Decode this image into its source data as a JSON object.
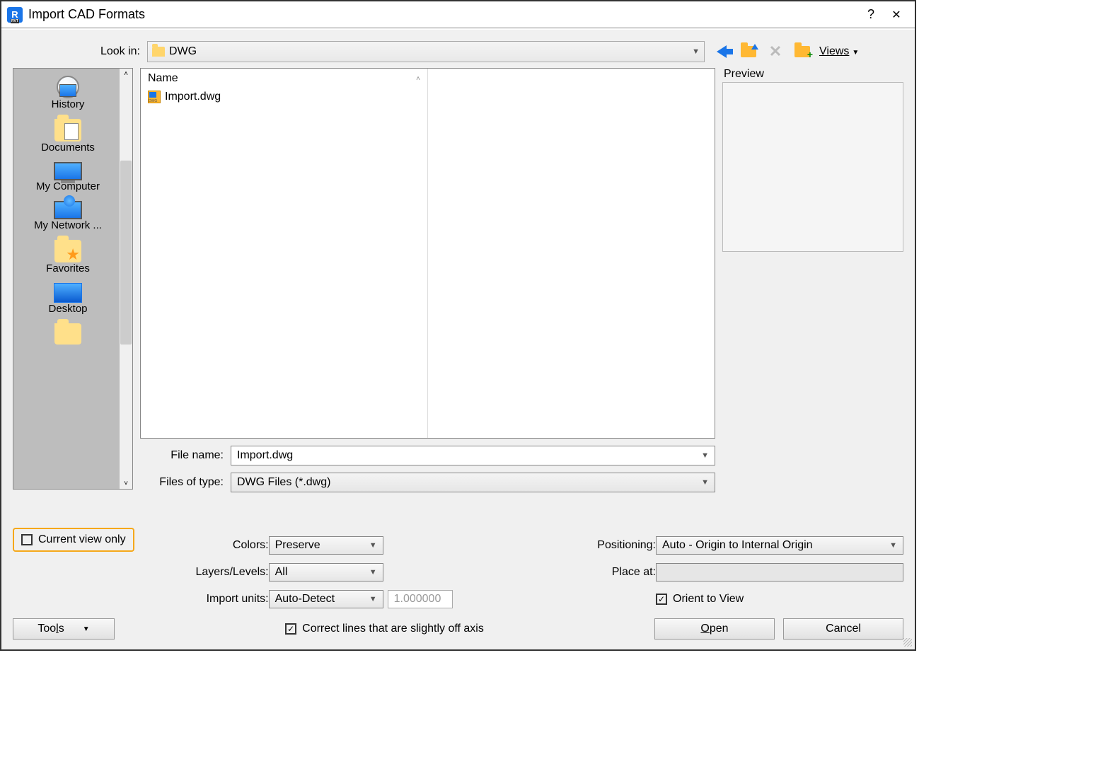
{
  "title": "Import CAD Formats",
  "lookin_label": "Look in:",
  "lookin_value": "DWG",
  "nav": {
    "views": "Views",
    "preview": "Preview"
  },
  "places": [
    {
      "label": "History",
      "icon": "history"
    },
    {
      "label": "Documents",
      "icon": "docs"
    },
    {
      "label": "My Computer",
      "icon": "computer"
    },
    {
      "label": "My Network ...",
      "icon": "network"
    },
    {
      "label": "Favorites",
      "icon": "fav"
    },
    {
      "label": "Desktop",
      "icon": "desktop"
    },
    {
      "label": "",
      "icon": "folder"
    }
  ],
  "columns": {
    "name": "Name"
  },
  "files": [
    {
      "name": "Import.dwg"
    }
  ],
  "file_name_label": "File name:",
  "file_name_value": "Import.dwg",
  "files_type_label": "Files of type:",
  "files_type_value": "DWG Files  (*.dwg)",
  "current_view_only": "Current view only",
  "colors_label": "Colors:",
  "colors_value": "Preserve",
  "layers_label": "Layers/Levels:",
  "layers_value": "All",
  "units_label": "Import units:",
  "units_value": "Auto-Detect",
  "units_scale": "1.000000",
  "correct_lines": "Correct lines that are slightly off axis",
  "positioning_label": "Positioning:",
  "positioning_value": "Auto - Origin to Internal Origin",
  "place_at_label": "Place at:",
  "orient_label": "Orient to View",
  "tools_label": "Tools",
  "open_label": "Open",
  "cancel_label": "Cancel"
}
